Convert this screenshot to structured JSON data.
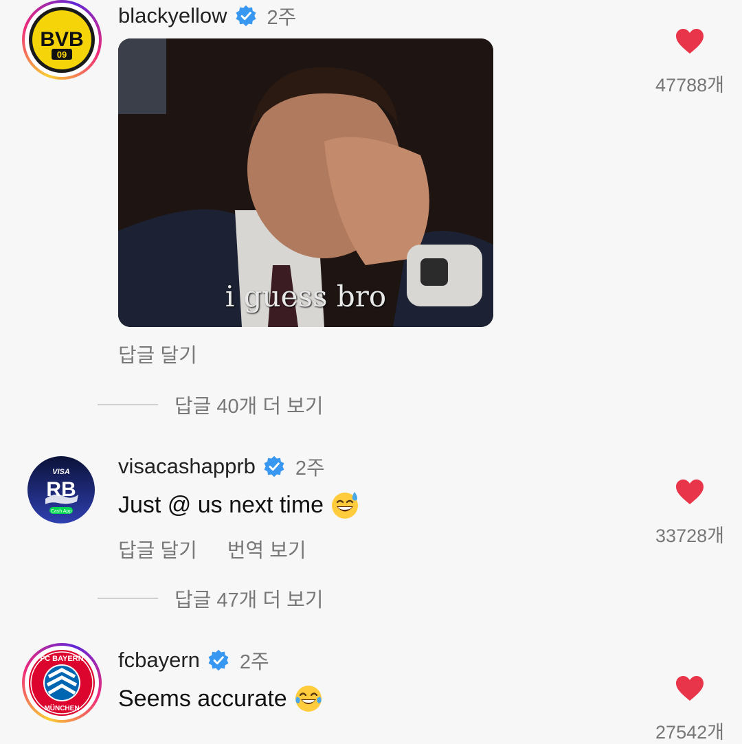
{
  "comments": [
    {
      "username": "blackyellow",
      "time": "2주",
      "gif_caption": "i guess bro",
      "actions": {
        "reply": "답글 달기"
      },
      "more_replies": "답글 40개 더 보기",
      "likes": "47788개",
      "avatar": {
        "type": "club-crest",
        "text": "BVB",
        "subtext": "09",
        "color": "#f5d40a"
      }
    },
    {
      "username": "visacashapprb",
      "time": "2주",
      "text": "Just @ us next time",
      "emoji": "grinning-sweat-emoji",
      "actions": {
        "reply": "답글 달기",
        "translate": "번역 보기"
      },
      "more_replies": "답글 47개 더 보기",
      "likes": "33728개",
      "avatar": {
        "type": "team-logo",
        "text_top": "VISA",
        "text_mid": "RB",
        "text_bottom": "Cash App",
        "color": "#1a2a8c"
      }
    },
    {
      "username": "fcbayern",
      "time": "2주",
      "text": "Seems accurate",
      "emoji": "tears-of-joy-emoji",
      "likes": "27542개",
      "avatar": {
        "type": "club-crest",
        "text_top": "FC BAYERN",
        "text_bottom": "MÜNCHEN",
        "color": "#dc052d"
      }
    }
  ],
  "colors": {
    "heart": "#e8354a",
    "verified": "#3897f0",
    "muted_text": "#777777"
  }
}
